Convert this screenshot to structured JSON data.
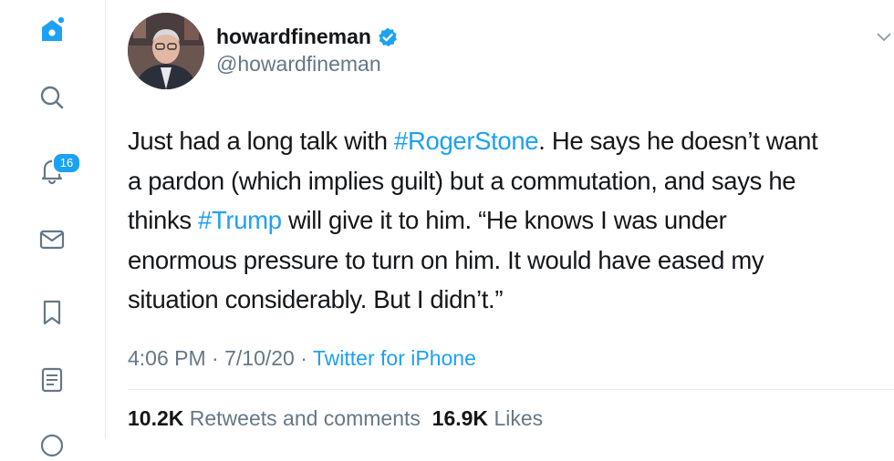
{
  "colors": {
    "accent": "#1da1f2",
    "secondary_text": "#657786",
    "primary_text": "#14171a",
    "divider": "#e6ecf0"
  },
  "sidebar": {
    "icons": [
      "home-icon",
      "search-icon",
      "notifications-icon",
      "messages-icon",
      "bookmarks-icon",
      "lists-icon",
      "profile-icon"
    ],
    "notifications_badge": "16"
  },
  "tweet": {
    "author": {
      "display_name": "howardfineman",
      "handle": "@howardfineman",
      "verified": true
    },
    "text_lines": [
      [
        {
          "t": "Just had a long talk with ",
          "tag": false
        },
        {
          "t": "#RogerStone",
          "tag": true
        },
        {
          "t": ". He says he doesn’t want",
          "tag": false
        }
      ],
      [
        {
          "t": "a pardon (which implies guilt) but a commutation, and says he",
          "tag": false
        }
      ],
      [
        {
          "t": "thinks ",
          "tag": false
        },
        {
          "t": "#Trump",
          "tag": true
        },
        {
          "t": " will give it to him. “He knows I was under",
          "tag": false
        }
      ],
      [
        {
          "t": "enormous pressure to turn on him. It would have eased my",
          "tag": false
        }
      ],
      [
        {
          "t": "situation considerably. But I didn’t.”",
          "tag": false
        }
      ]
    ],
    "time": "4:06 PM",
    "sep1": " · ",
    "date": "7/10/20",
    "sep2": " · ",
    "source": "Twitter for iPhone",
    "retweets_count": "10.2K",
    "retweets_label": "Retweets and comments",
    "likes_count": "16.9K",
    "likes_label": "Likes"
  }
}
